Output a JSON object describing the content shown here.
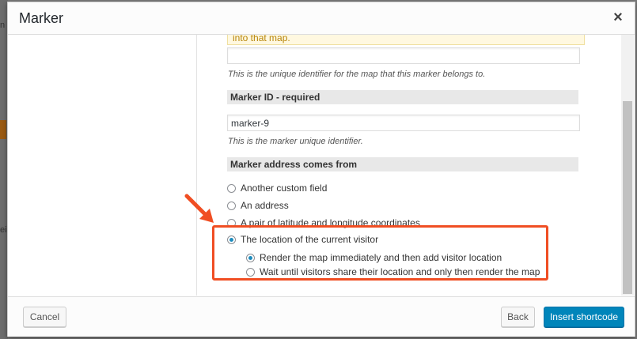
{
  "modal": {
    "title": "Marker",
    "close_glyph": "×"
  },
  "content": {
    "notice_text": "into that map.",
    "map_id_input_value": "",
    "map_id_description": "This is the unique identifier for the map that this marker belongs to.",
    "marker_id_heading": "Marker ID - required",
    "marker_id_value": "marker-9",
    "marker_id_description": "This is the marker unique identifier.",
    "address_heading": "Marker address comes from",
    "address_options": [
      {
        "label": "Another custom field",
        "checked": false
      },
      {
        "label": "An address",
        "checked": false
      },
      {
        "label": "A pair of latitude and longitude coordinates",
        "checked": false
      },
      {
        "label": "The location of the current visitor",
        "checked": true
      }
    ],
    "visitor_options": [
      {
        "label": "Render the map immediately and then add visitor location",
        "checked": true
      },
      {
        "label": "Wait until visitors share their location and only then render the map",
        "checked": false
      }
    ]
  },
  "footer": {
    "cancel_label": "Cancel",
    "back_label": "Back",
    "insert_label": "Insert shortcode"
  },
  "background": {
    "fragment_top": "n",
    "fragment_mid": "ei"
  },
  "colors": {
    "primary": "#0085ba",
    "highlight": "#f04e23",
    "radio_checked": "#1e8cbe"
  }
}
